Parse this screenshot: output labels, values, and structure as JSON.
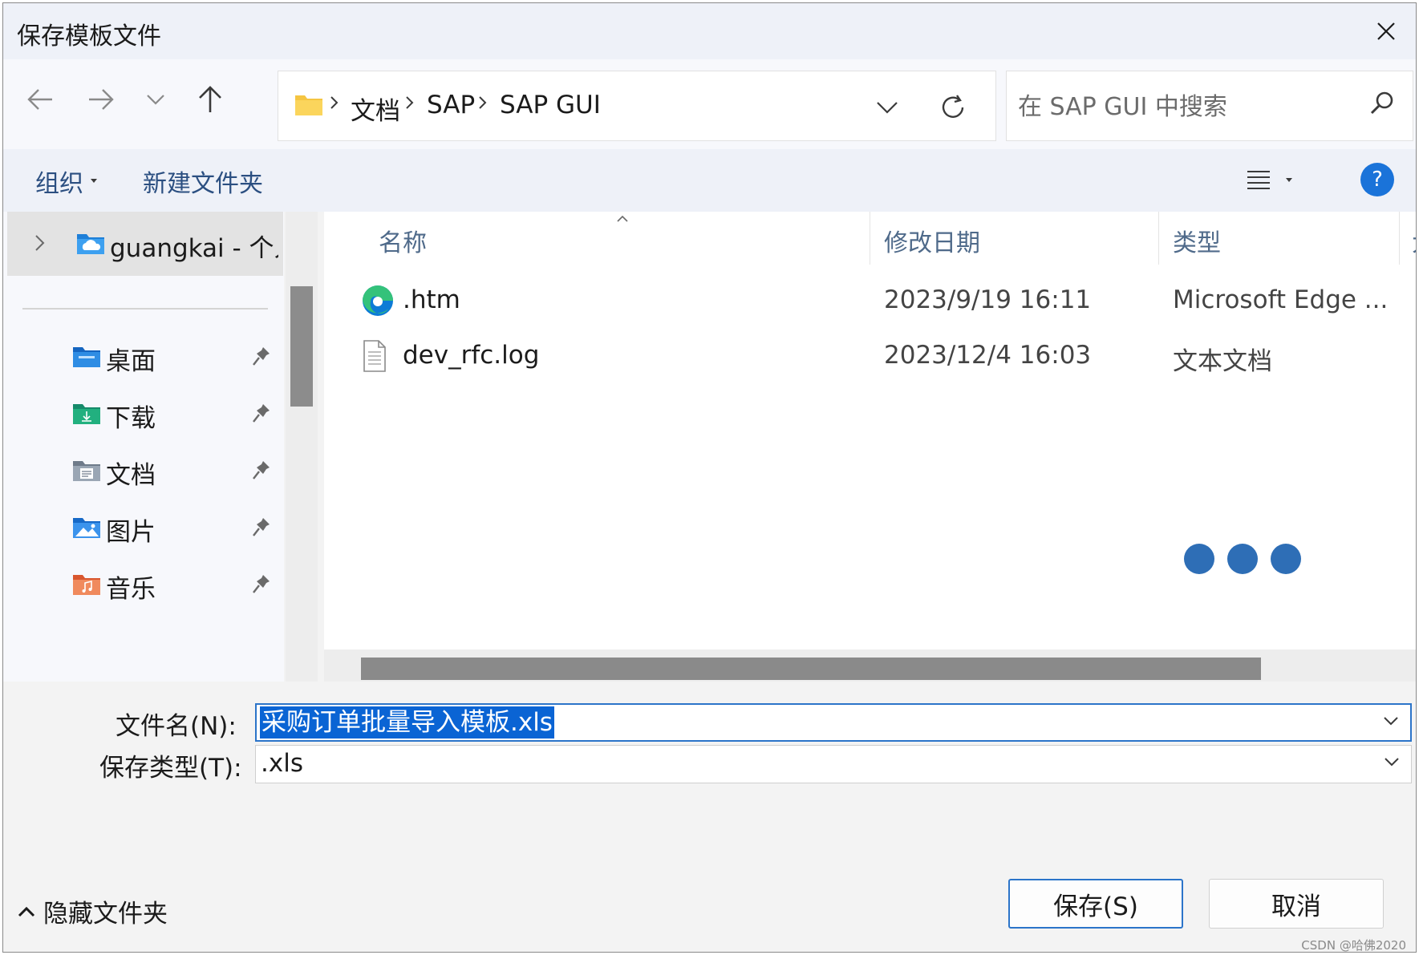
{
  "window": {
    "title": "保存模板文件"
  },
  "address": {
    "crumbs": [
      "文档",
      "SAP",
      "SAP GUI"
    ]
  },
  "search": {
    "placeholder": "在 SAP GUI 中搜索"
  },
  "toolbar": {
    "organize_label": "组织",
    "new_folder_label": "新建文件夹",
    "help_label": "?"
  },
  "sidebar": {
    "root_label": "guangkai - 个人",
    "quick_access": [
      {
        "label": "桌面",
        "icon": "desktop-folder-icon"
      },
      {
        "label": "下载",
        "icon": "downloads-folder-icon"
      },
      {
        "label": "文档",
        "icon": "documents-folder-icon"
      },
      {
        "label": "图片",
        "icon": "pictures-folder-icon"
      },
      {
        "label": "音乐",
        "icon": "music-folder-icon"
      }
    ]
  },
  "files": {
    "columns": {
      "name": "名称",
      "date": "修改日期",
      "type": "类型",
      "size": "大"
    },
    "rows": [
      {
        "name": ".htm",
        "date": "2023/9/19 16:11",
        "type": "Microsoft Edge ...",
        "icon": "edge-icon"
      },
      {
        "name": "dev_rfc.log",
        "date": "2023/12/4 16:03",
        "type": "文本文档",
        "icon": "text-file-icon"
      }
    ]
  },
  "footer": {
    "filename_label": "文件名(N):",
    "filename_value": "采购订单批量导入模板.xls",
    "filetype_label": "保存类型(T):",
    "filetype_value": ".xls",
    "hide_folders_label": "隐藏文件夹",
    "save_label": "保存(S)",
    "cancel_label": "取消",
    "watermark": "CSDN @哈佛2020"
  },
  "colors": {
    "accent": "#2b74c9",
    "selection": "#0a64d4",
    "loading": "#2e6eb6",
    "link": "#2b4f81"
  }
}
